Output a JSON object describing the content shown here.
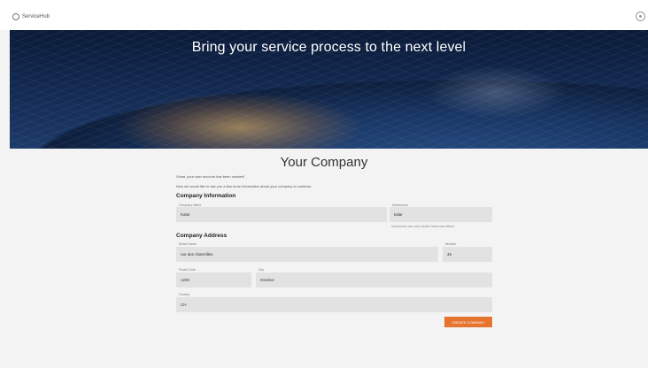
{
  "app": {
    "brand_name": "ServiceHub"
  },
  "header": {
    "settings_icon": "gear-icon"
  },
  "hero": {
    "title": "Bring your service process to the next level"
  },
  "form": {
    "title": "Your Company",
    "intro_line1": "Great, your user account has been created!",
    "intro_line2": "Now we would like to ask you a few more information about your company to continue.",
    "company_info": {
      "heading": "Company Information",
      "company_name_label": "Company Name",
      "company_name_value": "Kalar",
      "subdomain_label": "Subdomain",
      "subdomain_value": "kalar",
      "subdomain_hint": "Subdomain can only contain lowercase letters"
    },
    "company_address": {
      "heading": "Company Address",
      "street_label": "Street Name",
      "street_value": "rue des charmilles",
      "number_label": "Number",
      "number_value": "45",
      "postal_label": "Postal Code",
      "postal_value": "1200",
      "city_label": "City",
      "city_value": "Genève",
      "country_label": "Country",
      "country_value": "CH"
    },
    "submit_label": "CREATE COMPANY"
  },
  "colors": {
    "accent": "#e5742f",
    "field_bg": "#e2e2e2",
    "page_bg": "#f3f3f3",
    "hero_bg": "#12284f"
  }
}
